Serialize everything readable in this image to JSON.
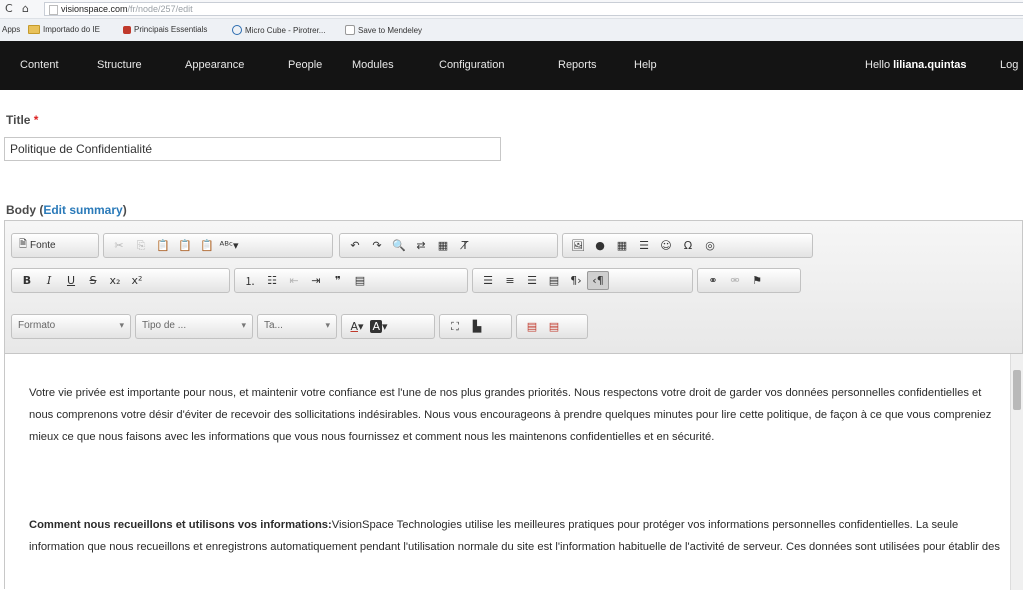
{
  "browser": {
    "back_glyph": "C",
    "home_glyph": "⌂",
    "url_host": "visionspace.com",
    "url_path": "/fr/node/257/edit",
    "bookmarks": [
      {
        "label": "Apps",
        "type": "text"
      },
      {
        "label": "Importado do IE",
        "type": "folder"
      },
      {
        "label": "Principais Essentials",
        "type": "icon",
        "color": "#c0392b"
      },
      {
        "label": "Micro Cube - Pirotrer...",
        "type": "icon",
        "color": "#2b6cb0"
      },
      {
        "label": "Save to Mendeley",
        "type": "page"
      }
    ]
  },
  "admin": {
    "menu": [
      "Content",
      "Structure",
      "Appearance",
      "People",
      "Modules",
      "Configuration",
      "Reports",
      "Help"
    ],
    "hello": "Hello ",
    "username": "liliana.quintas",
    "logout": "Log"
  },
  "form": {
    "title_label": "Title",
    "required_mark": "*",
    "title_value": "Politique de Confidentialité",
    "body_label": "Body (",
    "edit_summary": "Edit summary",
    "body_label_close": ")"
  },
  "toolbar": {
    "source_label": "Fonte",
    "format_label": "Formato",
    "style_label": "Tipo de ...",
    "size_label": "Ta..."
  },
  "body_text": {
    "p1": "Votre vie privée est importante pour nous, et maintenir votre confiance est l'une de nos plus grandes priorités. Nous respectons votre droit de garder vos données personnelles confidentielles et nous comprenons votre désir d'éviter de recevoir des sollicitations indésirables. Nous vous encourageons à prendre quelques minutes pour lire cette politique, de façon à ce que vous compreniez mieux ce que nous faisons avec les informations que vous nous fournissez et comment nous les maintenons confidentielles et en sécurité.",
    "p2_heading": "Comment nous recueillons et utilisons vos informations:",
    "p2": "VisionSpace Technologies utilise les meilleures pratiques pour protéger vos informations personnelles confidentielles. La seule information que nous recueillons et enregistrons automatiquement pendant l'utilisation normale du site est l'information habituelle de l'activité de serveur. Ces données sont utilisées pour établir des"
  }
}
